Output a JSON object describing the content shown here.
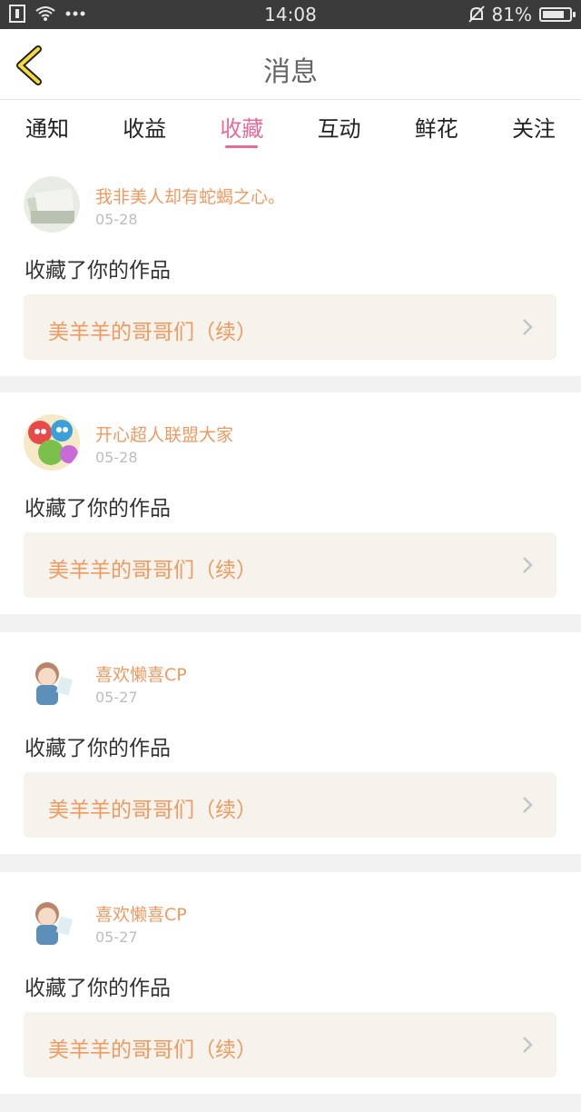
{
  "status": {
    "time": "14:08",
    "battery_percent": "81%",
    "battery_level": 0.81
  },
  "header": {
    "title": "消息"
  },
  "tabs": [
    {
      "label": "通知",
      "active": false
    },
    {
      "label": "收益",
      "active": false
    },
    {
      "label": "收藏",
      "active": true
    },
    {
      "label": "互动",
      "active": false
    },
    {
      "label": "鲜花",
      "active": false
    },
    {
      "label": "关注",
      "active": false
    }
  ],
  "colors": {
    "accent": "#e86a98",
    "orange": "#f09a62",
    "card_bg": "#f5f3ec"
  },
  "messages": [
    {
      "username": "我非美人却有蛇蝎之心。",
      "date": "05-28",
      "action": "收藏了你的作品",
      "work_title": "美羊羊的哥哥们（续）",
      "avatar_icon": "notebook-avatar"
    },
    {
      "username": "开心超人联盟大家",
      "date": "05-28",
      "action": "收藏了你的作品",
      "work_title": "美羊羊的哥哥们（续）",
      "avatar_icon": "superhero-avatar"
    },
    {
      "username": "喜欢懒喜CP",
      "date": "05-27",
      "action": "收藏了你的作品",
      "work_title": "美羊羊的哥哥们（续）",
      "avatar_icon": "anime-boy-avatar"
    },
    {
      "username": "喜欢懒喜CP",
      "date": "05-27",
      "action": "收藏了你的作品",
      "work_title": "美羊羊的哥哥们（续）",
      "avatar_icon": "anime-boy-avatar"
    }
  ]
}
